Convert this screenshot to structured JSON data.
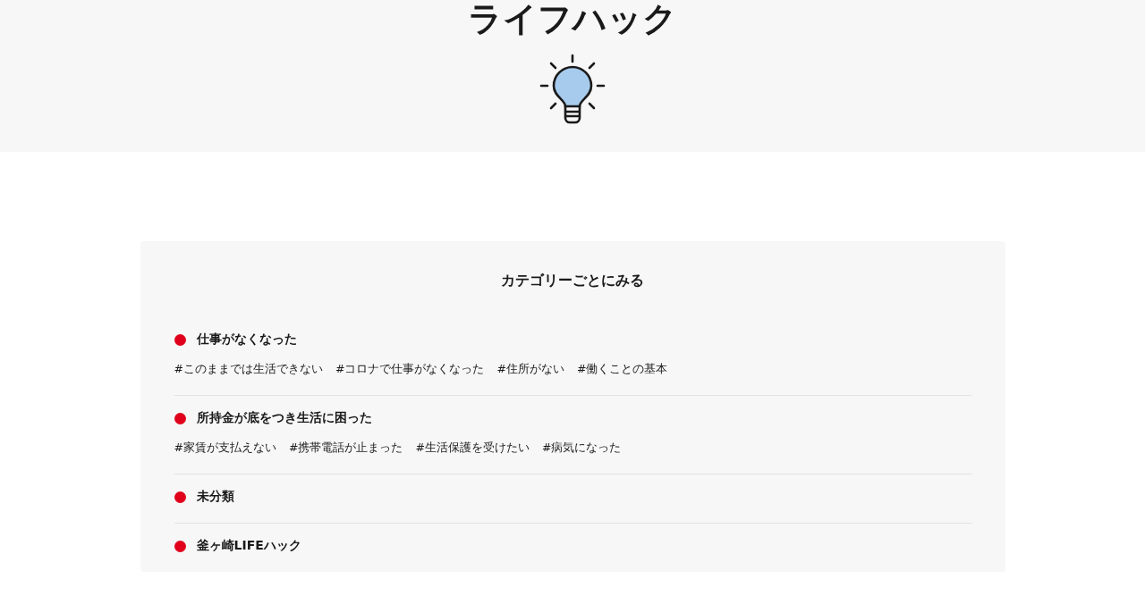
{
  "page_title": "ライフハック",
  "category_section": {
    "heading": "カテゴリーごとにみる",
    "categories": [
      {
        "name": "仕事がなくなった",
        "tags": [
          "#このままでは生活できない",
          "#コロナで仕事がなくなった",
          "#住所がない",
          "#働くことの基本"
        ]
      },
      {
        "name": "所持金が底をつき生活に困った",
        "tags": [
          "#家賃が支払えない",
          "#携帯電話が止まった",
          "#生活保護を受けたい",
          "#病気になった"
        ]
      },
      {
        "name": "未分類"
      },
      {
        "name": "釜ヶ崎LIFEハック"
      }
    ]
  }
}
